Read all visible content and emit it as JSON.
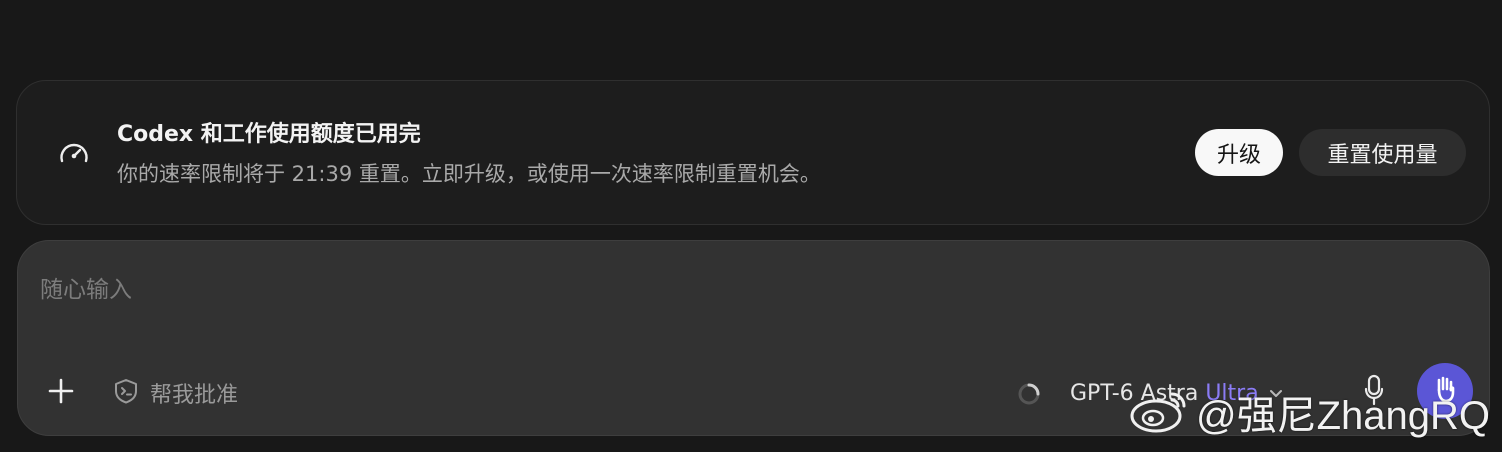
{
  "banner": {
    "icon": "speedometer-icon",
    "title": "Codex 和工作使用额度已用完",
    "description": "你的速率限制将于 21:39 重置。立即升级，或使用一次速率限制重置机会。",
    "upgrade_label": "升级",
    "reset_label": "重置使用量"
  },
  "composer": {
    "placeholder": "随心输入",
    "add_icon": "plus-icon",
    "approval_icon": "shield-terminal-icon",
    "approval_label": "帮我批准",
    "model_name": "GPT-6 Astra",
    "model_tier": "Ultra",
    "model_chevron": "chevron-down-icon",
    "mic_icon": "microphone-icon",
    "send_icon": "hand-icon"
  },
  "watermark": {
    "text": "@强尼ZhangRQ",
    "icon": "weibo-icon"
  },
  "colors": {
    "background": "#181818",
    "accent": "#5b56d6",
    "tier": "#8b7cf6"
  }
}
